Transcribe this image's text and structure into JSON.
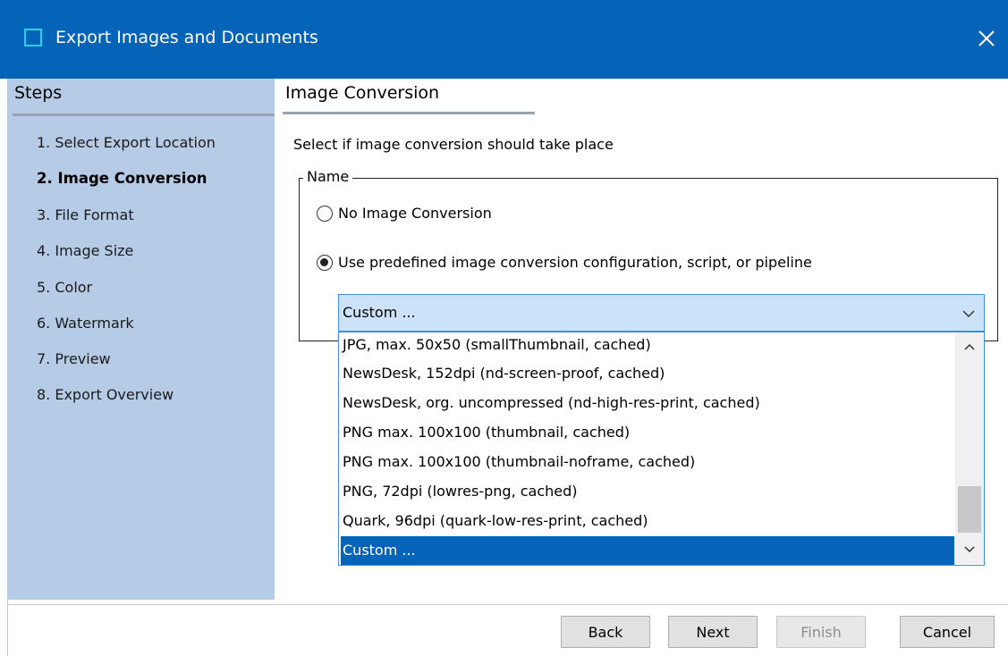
{
  "window": {
    "title": "Export Images and Documents",
    "close_icon": "close-icon"
  },
  "steps": {
    "title": "Steps",
    "items": [
      {
        "label": "1. Select Export Location"
      },
      {
        "label": "2. Image Conversion",
        "active": true
      },
      {
        "label": "3. File Format"
      },
      {
        "label": "4. Image Size"
      },
      {
        "label": "5. Color"
      },
      {
        "label": "6. Watermark"
      },
      {
        "label": "7. Preview"
      },
      {
        "label": "8. Export Overview"
      }
    ]
  },
  "content": {
    "title": "Image Conversion",
    "description": "Select if image conversion should take place",
    "group_label": "Name",
    "radio_none": "No Image Conversion",
    "radio_predefined": "Use predefined image conversion configuration, script, or pipeline",
    "selected_radio": "predefined",
    "combo_value": "Custom ...",
    "dropdown_options": [
      "JPG, max. 50x50 (smallThumbnail, cached)",
      "NewsDesk, 152dpi (nd-screen-proof, cached)",
      "NewsDesk, org. uncompressed (nd-high-res-print, cached)",
      "PNG max. 100x100 (thumbnail, cached)",
      "PNG max. 100x100 (thumbnail-noframe, cached)",
      "PNG, 72dpi (lowres-png, cached)",
      "Quark, 96dpi (quark-low-res-print, cached)",
      "Custom ..."
    ],
    "highlighted_option": "Custom ..."
  },
  "buttons": {
    "back": "Back",
    "next": "Next",
    "finish": "Finish",
    "cancel": "Cancel"
  },
  "colors": {
    "titlebar": "#0563b8",
    "steps_panel": "#b5cbe6",
    "selection": "#0563b8"
  }
}
